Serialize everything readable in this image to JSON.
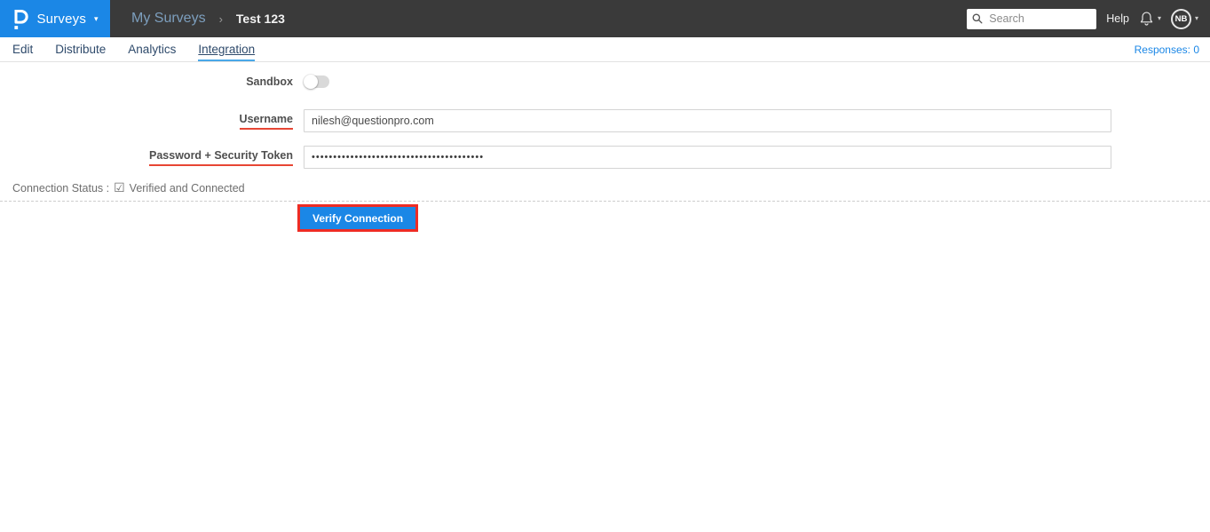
{
  "topbar": {
    "brand": {
      "label": "Surveys"
    },
    "breadcrumb": {
      "parent": "My Surveys",
      "current": "Test 123"
    },
    "search": {
      "placeholder": "Search",
      "value": ""
    },
    "help_label": "Help",
    "avatar_initials": "NB"
  },
  "icons": {
    "caret_down": "▾",
    "breadcrumb_separator": "›",
    "checkbox_checked": "☑"
  },
  "tabs": {
    "items": [
      {
        "label": "Edit",
        "active": false
      },
      {
        "label": "Distribute",
        "active": false
      },
      {
        "label": "Analytics",
        "active": false
      },
      {
        "label": "Integration",
        "active": true
      }
    ],
    "responses_label": "Responses: 0"
  },
  "form": {
    "sandbox": {
      "label": "Sandbox",
      "enabled": false
    },
    "username": {
      "label": "Username",
      "value": "nilesh@questionpro.com"
    },
    "password": {
      "label": "Password + Security Token",
      "value": "••••••••••••••••••••••••••••••••••••••••"
    },
    "connection_status": {
      "label": "Connection Status :",
      "value": "Verified and Connected"
    },
    "verify_button_label": "Verify Connection"
  },
  "colors": {
    "brand_blue": "#1b87e6",
    "topbar_bg": "#3a3a3a",
    "tab_text": "#2e4a6b",
    "active_tab_underline": "#49a8e8",
    "required_underline_red": "#e74634",
    "highlight_red": "#ee2c24",
    "responses_blue": "#1b87e6"
  }
}
